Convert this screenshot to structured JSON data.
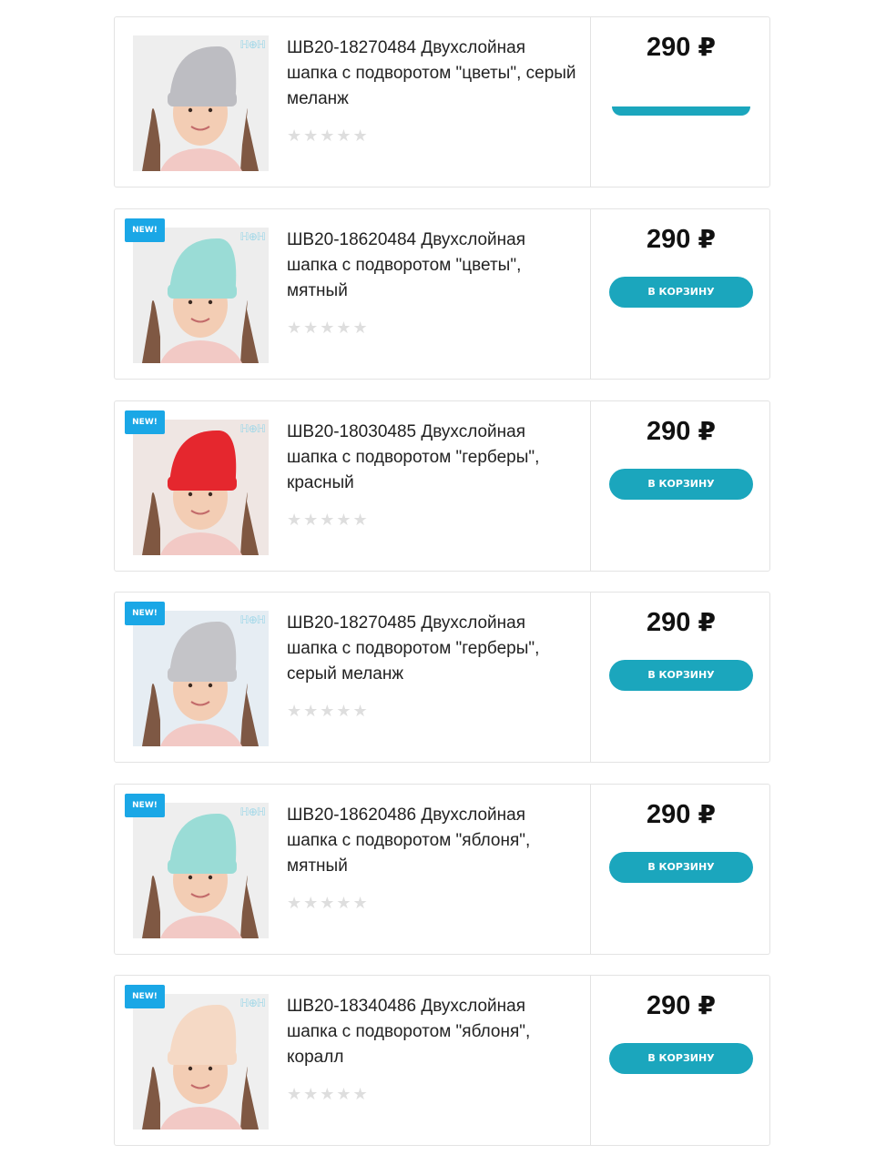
{
  "products": [
    {
      "title": "ШВ20-18270484 Двухслойная шапка с подворотом \"цветы\", серый меланж",
      "stars": "★★★★★",
      "price": "290",
      "currency": "₽",
      "badge": "",
      "cart_label": "",
      "hat_color": "#bdbdc2",
      "bg_color": "#eeeeee",
      "button_visible": "partial"
    },
    {
      "title": "ШВ20-18620484 Двухслойная шапка с подворотом \"цветы\", мятный",
      "stars": "★★★★★",
      "price": "290",
      "currency": "₽",
      "badge": "NEW!",
      "cart_label": "В КОРЗИНУ",
      "hat_color": "#9adcd6",
      "bg_color": "#ededed",
      "button_visible": "full"
    },
    {
      "title": "ШВ20-18030485 Двухслойная шапка с подворотом \"герберы\", красный",
      "stars": "★★★★★",
      "price": "290",
      "currency": "₽",
      "badge": "NEW!",
      "cart_label": "В КОРЗИНУ",
      "hat_color": "#e5272e",
      "bg_color": "#efe6e3",
      "button_visible": "full"
    },
    {
      "title": "ШВ20-18270485 Двухслойная шапка с подворотом \"герберы\", серый меланж",
      "stars": "★★★★★",
      "price": "290",
      "currency": "₽",
      "badge": "NEW!",
      "cart_label": "В КОРЗИНУ",
      "hat_color": "#c4c4c8",
      "bg_color": "#e6edf3",
      "button_visible": "full"
    },
    {
      "title": "ШВ20-18620486 Двухслойная шапка с подворотом \"яблоня\", мятный",
      "stars": "★★★★★",
      "price": "290",
      "currency": "₽",
      "badge": "NEW!",
      "cart_label": "В КОРЗИНУ",
      "hat_color": "#9adcd6",
      "bg_color": "#eeeeee",
      "button_visible": "full"
    },
    {
      "title": "ШВ20-18340486 Двухслойная шапка с подворотом \"яблоня\", коралл",
      "stars": "★★★★★",
      "price": "290",
      "currency": "₽",
      "badge": "NEW!",
      "cart_label": "В КОРЗИНУ",
      "hat_color": "#f5d9c5",
      "bg_color": "#efefef",
      "button_visible": "full"
    }
  ],
  "colors": {
    "button": "#1ba6bd",
    "badge": "#1aa7e6",
    "border": "#e3e3e3",
    "star_empty": "#dedede"
  },
  "icons": {
    "rating": "star-icon",
    "brand": "brand-logo-icon"
  }
}
